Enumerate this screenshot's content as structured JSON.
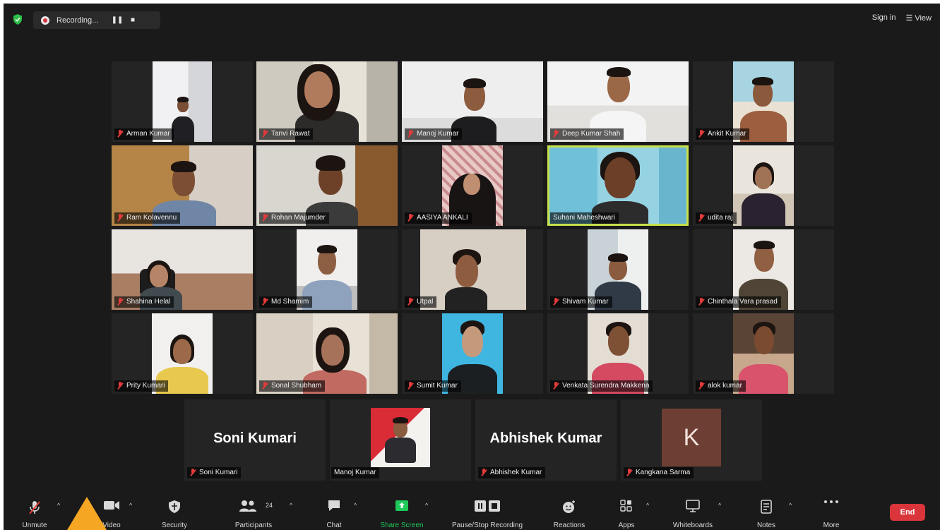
{
  "topbar": {
    "recording_label": "Recording...",
    "pause_label": "❚❚",
    "stop_label": "■",
    "sign_in_label": "Sign in",
    "view_label": "☰ View"
  },
  "participants": [
    {
      "name": "Arman Kumar"
    },
    {
      "name": "Tanvi Rawat"
    },
    {
      "name": "Manoj Kumar"
    },
    {
      "name": "Deep Kumar Shah"
    },
    {
      "name": "Ankit Kumar"
    },
    {
      "name": "Ram Kolavennu"
    },
    {
      "name": "Rohan Majumder"
    },
    {
      "name": "AASIYA  ANKALI"
    },
    {
      "name": "Suhani Maheshwari"
    },
    {
      "name": "udita raj"
    },
    {
      "name": "Shahina Helal"
    },
    {
      "name": "Md Shamim"
    },
    {
      "name": "Utpal"
    },
    {
      "name": "Shivam Kumar"
    },
    {
      "name": "Chinthala Vara prasad"
    },
    {
      "name": "Prity Kumari"
    },
    {
      "name": "Sonal Shubham"
    },
    {
      "name": "Sumit Kumar"
    },
    {
      "name": "Venkata Surendra Makkena"
    },
    {
      "name": "alok kumar"
    }
  ],
  "bottom_row": [
    {
      "display": "Soni Kumari",
      "name": "Soni Kumari"
    },
    {
      "display": "",
      "name": "Manoj Kumar"
    },
    {
      "display": "Abhishek Kumar",
      "name": "Abhishek Kumar"
    },
    {
      "display": "K",
      "name": "Kangkana Sarma"
    }
  ],
  "toolbar": {
    "unmute": "Unmute",
    "video": "Video",
    "security": "Security",
    "participants": "Participants",
    "participants_count": "24",
    "chat": "Chat",
    "share_screen": "Share Screen",
    "pause_stop_recording": "Pause/Stop Recording",
    "reactions": "Reactions",
    "apps": "Apps",
    "whiteboards": "Whiteboards",
    "notes": "Notes",
    "more": "More",
    "end": "End"
  },
  "icons": {
    "security_shield": "shield-icon",
    "record": "record-icon",
    "muted_mic": "mic-off-icon"
  },
  "colors": {
    "background": "#1a1a1a",
    "tile": "#242424",
    "active_speaker_border": "#c8e04a",
    "end_button": "#d9353b",
    "share_screen": "#1ec95a",
    "muted_mic": "#e23b3b",
    "cursor": "#f5a623"
  }
}
